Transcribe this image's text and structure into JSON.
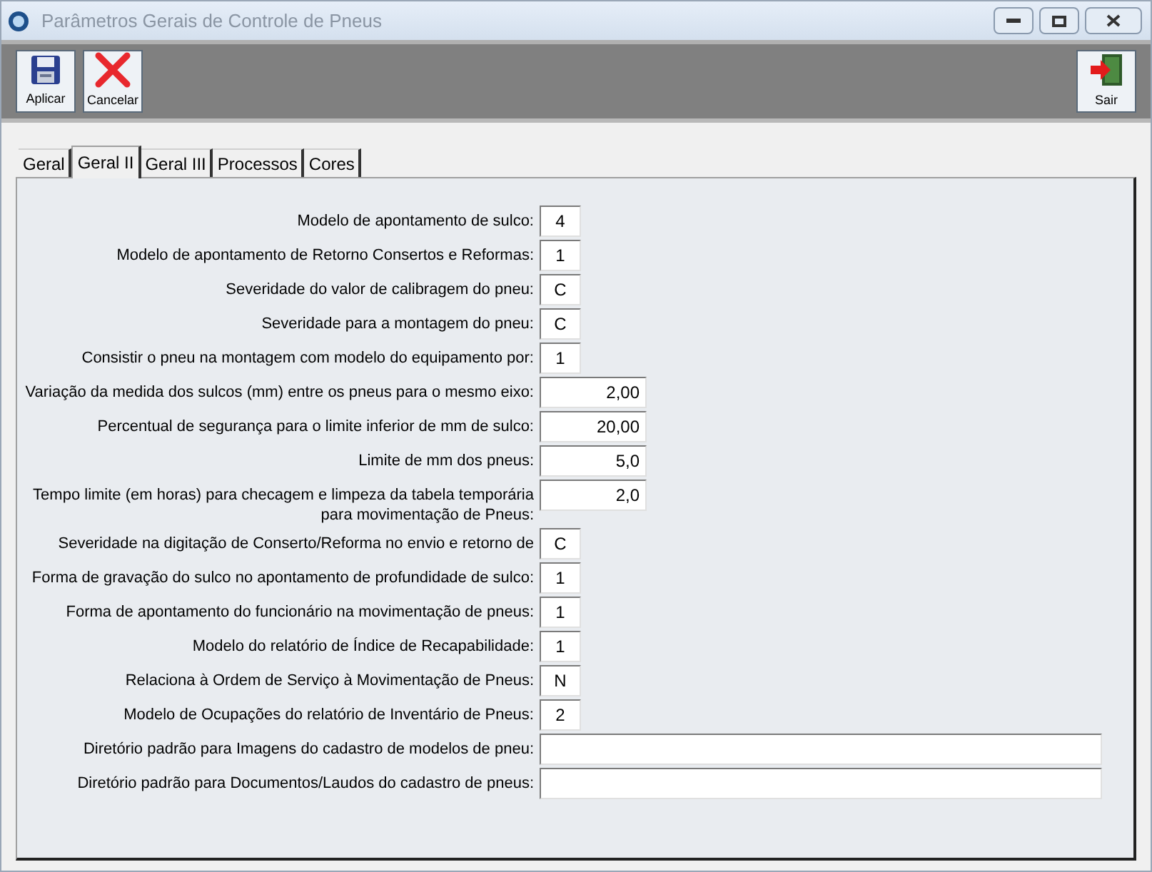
{
  "window": {
    "title": "Parâmetros Gerais de Controle de Pneus"
  },
  "toolbar": [
    {
      "kind": "save",
      "label": "Aplicar"
    },
    {
      "kind": "cancel",
      "label": "Cancelar"
    },
    {
      "kind": "exit",
      "label": "Sair"
    }
  ],
  "tabs": [
    {
      "label": "Geral",
      "selected": false
    },
    {
      "label": "Geral II",
      "selected": true
    },
    {
      "label": "Geral III",
      "selected": false
    },
    {
      "label": "Processos",
      "selected": false
    },
    {
      "label": "Cores",
      "selected": false
    }
  ],
  "fields": [
    {
      "label": "Modelo de apontamento de sulco:",
      "value": "4",
      "kind": "short"
    },
    {
      "label": "Modelo de apontamento de Retorno Consertos e Reformas:",
      "value": "1",
      "kind": "short"
    },
    {
      "label": "Severidade do valor de calibragem do pneu:",
      "value": "C",
      "kind": "short"
    },
    {
      "label": "Severidade para a montagem do pneu:",
      "value": "C",
      "kind": "short"
    },
    {
      "label": "Consistir o pneu na montagem com modelo do equipamento por:",
      "value": "1",
      "kind": "short"
    },
    {
      "label": "Variação da medida dos sulcos (mm) entre os pneus para o mesmo eixo:",
      "value": "2,00",
      "kind": "medium"
    },
    {
      "label": "Percentual de segurança para o limite inferior de mm de sulco:",
      "value": "20,00",
      "kind": "medium"
    },
    {
      "label": "Limite de mm dos pneus:",
      "value": "5,0",
      "kind": "medium"
    },
    {
      "label": "Tempo limite (em horas) para checagem e limpeza da tabela temporária para movimentação de Pneus:",
      "value": "2,0",
      "kind": "medium"
    },
    {
      "label": "Severidade na digitação de Conserto/Reforma no envio e retorno de",
      "value": "C",
      "kind": "short"
    },
    {
      "label": "Forma de gravação do sulco no apontamento de profundidade de sulco:",
      "value": "1",
      "kind": "short"
    },
    {
      "label": "Forma de apontamento do funcionário na movimentação de pneus:",
      "value": "1",
      "kind": "short"
    },
    {
      "label": "Modelo do relatório de Índice de Recapabilidade:",
      "value": "1",
      "kind": "short"
    },
    {
      "label": "Relaciona à Ordem de Serviço à Movimentação de Pneus:",
      "value": "N",
      "kind": "short"
    },
    {
      "label": "Modelo de Ocupações do relatório de Inventário de Pneus:",
      "value": "2",
      "kind": "short"
    },
    {
      "label": "Diretório padrão para Imagens do cadastro de modelos de pneu:",
      "kind": "long"
    },
    {
      "label": "Diretório padrão para Documentos/Laudos do cadastro de pneus:",
      "kind": "long"
    }
  ]
}
